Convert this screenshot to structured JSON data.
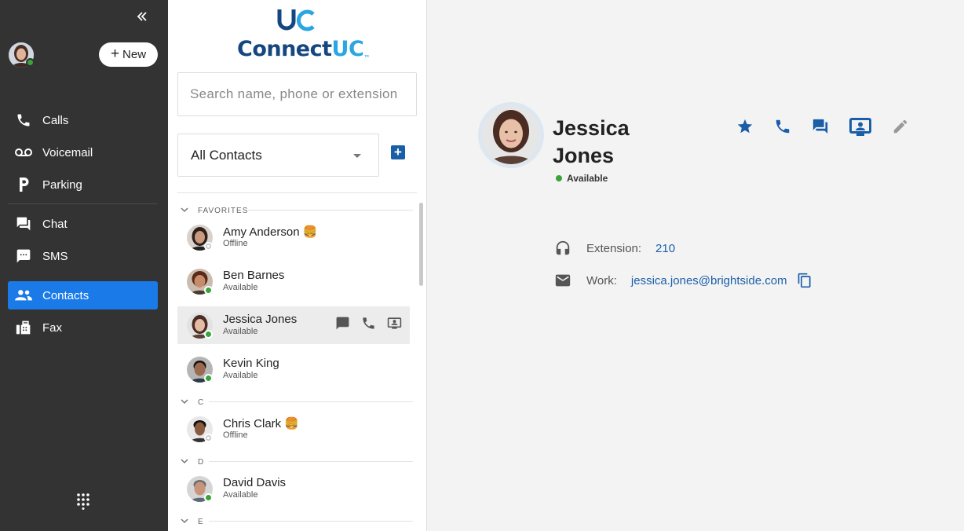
{
  "sidebar": {
    "new_label": "New",
    "nav": [
      {
        "label": "Calls",
        "icon": "phone-icon"
      },
      {
        "label": "Voicemail",
        "icon": "voicemail-icon"
      },
      {
        "label": "Parking",
        "icon": "parking-icon"
      },
      {
        "label": "Chat",
        "icon": "chat-icon"
      },
      {
        "label": "SMS",
        "icon": "sms-icon"
      },
      {
        "label": "Contacts",
        "icon": "contacts-icon"
      },
      {
        "label": "Fax",
        "icon": "fax-icon"
      }
    ],
    "active": "Contacts",
    "accent": "#1a7ae8"
  },
  "brand": {
    "name_a": "Connect",
    "name_b": "UC",
    "tm": "™",
    "mark": "UC"
  },
  "contacts_panel": {
    "search_placeholder": "Search name, phone or extension",
    "filter_value": "All Contacts",
    "groups": [
      {
        "header": "FAVORITES",
        "contacts": [
          {
            "name": "Amy Anderson",
            "emoji": "🍔",
            "status": "Offline"
          },
          {
            "name": "Ben Barnes",
            "emoji": "",
            "status": "Available"
          },
          {
            "name": "Jessica Jones",
            "emoji": "",
            "status": "Available"
          },
          {
            "name": "Kevin King",
            "emoji": "",
            "status": "Available"
          }
        ]
      },
      {
        "header": "C",
        "contacts": [
          {
            "name": "Chris Clark",
            "emoji": "🍔",
            "status": "Offline"
          }
        ]
      },
      {
        "header": "D",
        "contacts": [
          {
            "name": "David Davis",
            "emoji": "",
            "status": "Available"
          }
        ]
      },
      {
        "header": "E",
        "contacts": []
      }
    ]
  },
  "detail": {
    "first_name": "Jessica",
    "last_name": "Jones",
    "status": "Available",
    "extension_label": "Extension:",
    "extension_value": "210",
    "work_label": "Work:",
    "work_value": "jessica.jones@brightside.com"
  },
  "colors": {
    "available": "#3aa339",
    "link": "#1a5ea8",
    "icon_blue": "#1a5ea8"
  }
}
